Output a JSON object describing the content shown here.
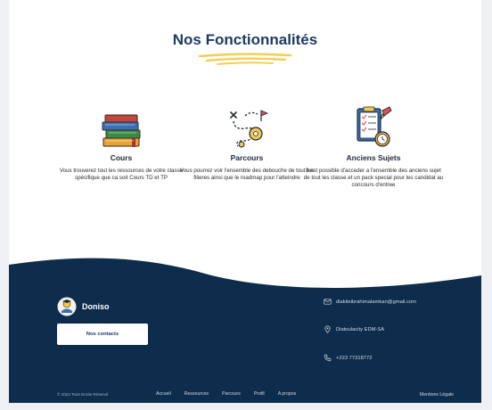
{
  "features": {
    "title": "Nos Fonctionnalités",
    "items": [
      {
        "icon": "books-icon",
        "title": "Cours",
        "description": "Vous trouverez tout les ressources de votre classe spécifique que ca soit Cours TD  et TP"
      },
      {
        "icon": "roadmap-icon",
        "title": "Parcours",
        "description": "Vous pourrez voir l'ensemble des debouche de tout les filieres ainsi que le roadmap pour l'atteindre"
      },
      {
        "icon": "exam-clipboard-icon",
        "title": "Anciens Sujets",
        "description": "Il est possible d'acceder a l'ensemble des anciens sujet de tout les classe et un pack special pour les candidat au concours d'entree"
      }
    ]
  },
  "footer": {
    "brand_name": "Doniso",
    "contacts_button": "Nos contacts",
    "email": "diakiteibrahimalamkan@gmail.com",
    "address": "Diatoulacity EDM-SA",
    "phone": "+223 77318772",
    "copyright": "© 2024 Tous Droits Réservé",
    "nav": [
      "Accueil",
      "Ressources",
      "Parcours",
      "Profil",
      "A propos"
    ],
    "legal": "Mentions Légale",
    "colors": {
      "background": "#0e2d4c",
      "accent": "#f2c94c"
    }
  }
}
